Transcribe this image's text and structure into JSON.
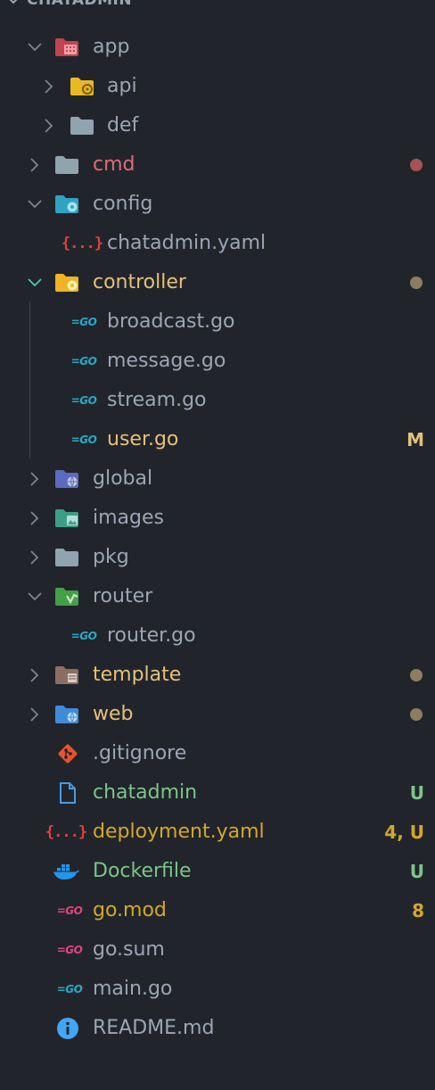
{
  "explorer": {
    "section_title": "CHATADMIN",
    "colors": {
      "background": "#21252b",
      "default_text": "#9da5b4",
      "modified": "#e5c07b",
      "untracked": "#98c379",
      "error": "#e06c75",
      "warning_text": "#d19a66",
      "dot_gray": "#8c7e63",
      "dot_red": "#a65353"
    },
    "items": [
      {
        "label": "app",
        "type": "folder",
        "expanded": true,
        "icon": "app-folder-icon"
      },
      {
        "label": "api",
        "type": "folder",
        "expanded": false,
        "icon": "api-folder-icon"
      },
      {
        "label": "def",
        "type": "folder",
        "expanded": false,
        "icon": "folder-icon"
      },
      {
        "label": "cmd",
        "type": "folder",
        "expanded": false,
        "icon": "folder-icon"
      },
      {
        "label": "config",
        "type": "folder",
        "expanded": true,
        "icon": "config-folder-icon"
      },
      {
        "label": "chatadmin.yaml",
        "type": "file",
        "icon": "yaml-icon"
      },
      {
        "label": "controller",
        "type": "folder",
        "expanded": true,
        "icon": "controller-folder-icon"
      },
      {
        "label": "broadcast.go",
        "type": "file",
        "icon": "go-icon"
      },
      {
        "label": "message.go",
        "type": "file",
        "icon": "go-icon"
      },
      {
        "label": "stream.go",
        "type": "file",
        "icon": "go-icon"
      },
      {
        "label": "user.go",
        "type": "file",
        "icon": "go-icon",
        "badge": "M"
      },
      {
        "label": "global",
        "type": "folder",
        "expanded": false,
        "icon": "global-folder-icon"
      },
      {
        "label": "images",
        "type": "folder",
        "expanded": false,
        "icon": "images-folder-icon"
      },
      {
        "label": "pkg",
        "type": "folder",
        "expanded": false,
        "icon": "folder-icon"
      },
      {
        "label": "router",
        "type": "folder",
        "expanded": true,
        "icon": "router-folder-icon"
      },
      {
        "label": "router.go",
        "type": "file",
        "icon": "go-icon"
      },
      {
        "label": "template",
        "type": "folder",
        "expanded": false,
        "icon": "template-folder-icon"
      },
      {
        "label": "web",
        "type": "folder",
        "expanded": false,
        "icon": "web-folder-icon"
      },
      {
        "label": ".gitignore",
        "type": "file",
        "icon": "git-icon"
      },
      {
        "label": "chatadmin",
        "type": "file",
        "icon": "file-icon",
        "badge": "U"
      },
      {
        "label": "deployment.yaml",
        "type": "file",
        "icon": "yaml-icon",
        "badge": "4, U"
      },
      {
        "label": "Dockerfile",
        "type": "file",
        "icon": "docker-icon",
        "badge": "U"
      },
      {
        "label": "go.mod",
        "type": "file",
        "icon": "gomod-icon",
        "badge": "8"
      },
      {
        "label": "go.sum",
        "type": "file",
        "icon": "gomod-icon"
      },
      {
        "label": "main.go",
        "type": "file",
        "icon": "go-icon"
      },
      {
        "label": "README.md",
        "type": "file",
        "icon": "info-icon"
      }
    ]
  }
}
